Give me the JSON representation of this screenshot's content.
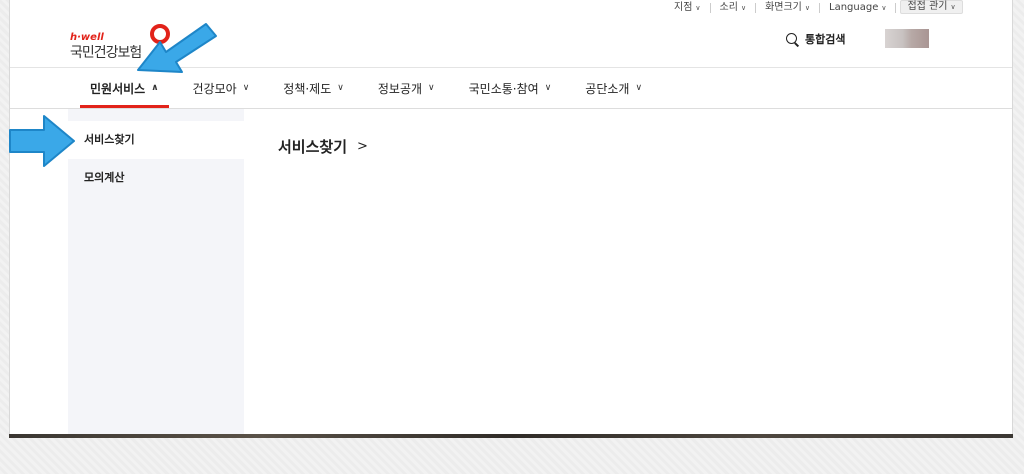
{
  "utility_bar": [
    {
      "label": "지점",
      "chevron": true
    },
    {
      "label": "소리",
      "chevron": true
    },
    {
      "label": "화면크기",
      "chevron": true
    },
    {
      "label": "Language",
      "chevron": true
    },
    {
      "label": "접접 관기",
      "chevron": true
    }
  ],
  "logo": {
    "brand": "h·well",
    "name": "국민건강보험"
  },
  "header": {
    "search_label": "통합검색"
  },
  "nav": [
    {
      "label": "민원서비스",
      "chevron": "up",
      "active": true
    },
    {
      "label": "건강모아",
      "chevron": "down"
    },
    {
      "label": "정책·제도",
      "chevron": "down"
    },
    {
      "label": "정보공개",
      "chevron": "down"
    },
    {
      "label": "국민소통·참여",
      "chevron": "down"
    },
    {
      "label": "공단소개",
      "chevron": "down"
    }
  ],
  "sidebar": {
    "items": [
      {
        "label": "서비스찾기",
        "active": true
      },
      {
        "label": "모의계산",
        "active": false
      }
    ]
  },
  "main": {
    "title": "서비스찾기"
  },
  "colors": {
    "accent": "#e2231a",
    "arrow": "#3aa8e8",
    "sidebar_bg": "#f4f5f9"
  }
}
